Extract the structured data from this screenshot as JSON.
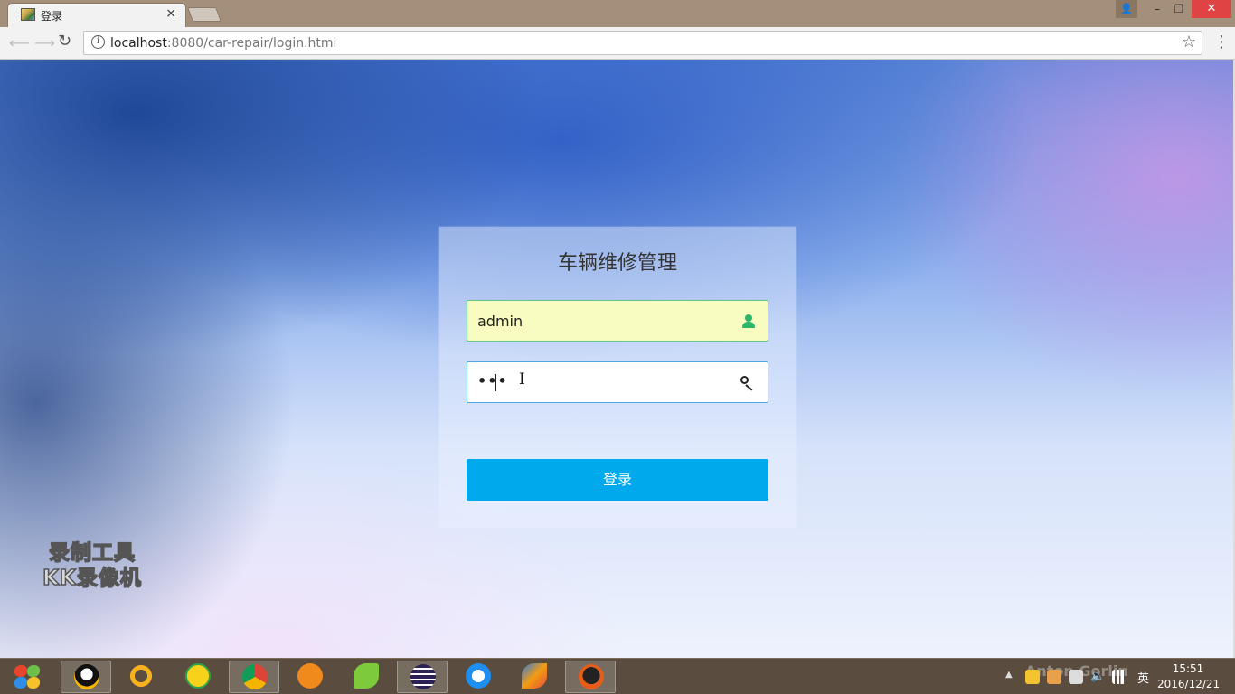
{
  "browser": {
    "tab": {
      "title": "登录",
      "close": "×"
    },
    "address": {
      "host": "localhost",
      "path": ":8080/car-repair/login.html"
    },
    "window_controls": {
      "minimize": "–",
      "maximize": "❐",
      "close": "✕",
      "user": "👤"
    }
  },
  "login": {
    "title": "车辆维修管理",
    "username_value": "admin",
    "password_value": "•••",
    "submit_label": "登录"
  },
  "watermark": {
    "line1": "录制工具",
    "line2": "KK录像机"
  },
  "taskbar": {
    "apps": [
      "qq-icon",
      "sogou-icon",
      "qq-music-icon",
      "chrome-icon",
      "wifi-icon",
      "leaf-icon",
      "eclipse-icon",
      "browser-icon",
      "feather-icon",
      "ninja-icon"
    ],
    "active_app": "chrome-icon",
    "tray_lang": "英",
    "tray_overlay": "Anton Gorlin",
    "time": "15:51",
    "date": "2016/12/21"
  },
  "colors": {
    "button": "#00a9ec",
    "user_field_bg": "#f8fcc0",
    "user_icon": "#2bb66a"
  }
}
